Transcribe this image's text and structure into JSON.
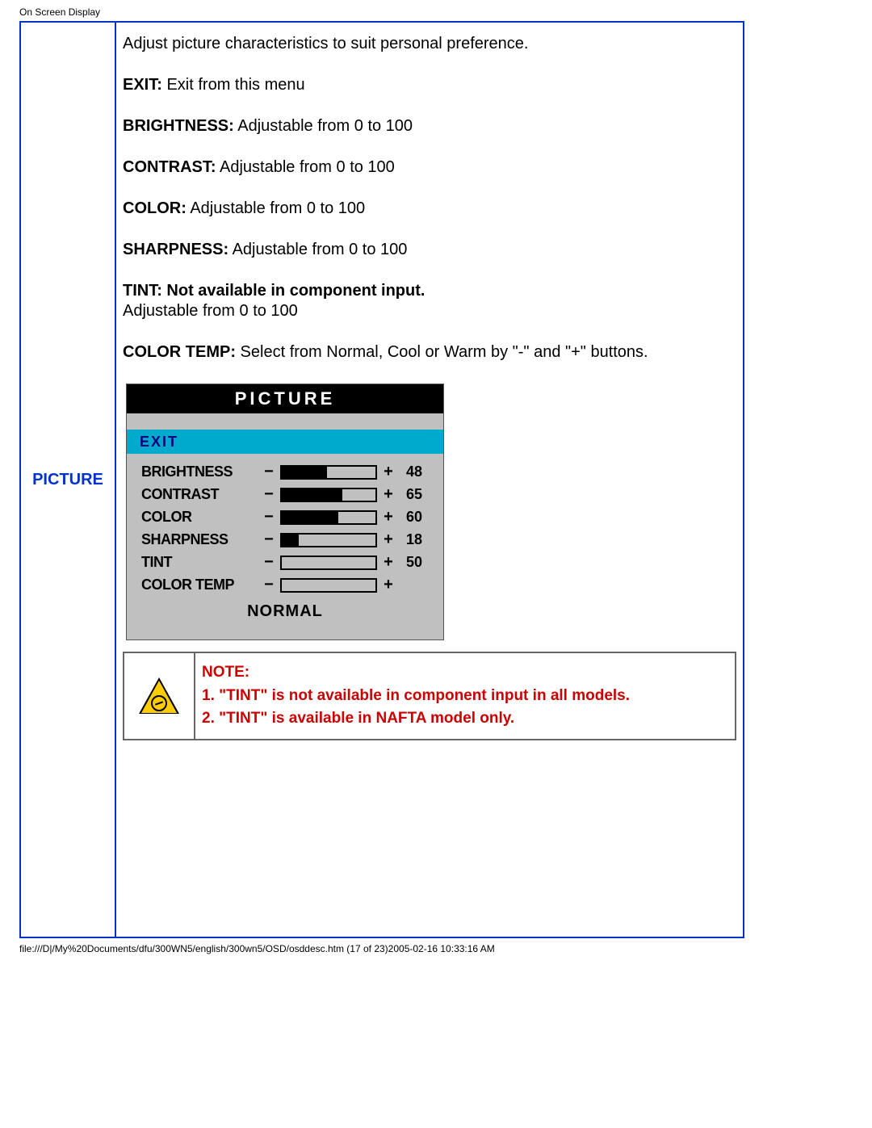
{
  "header": "On Screen Display",
  "footer": "file:///D|/My%20Documents/dfu/300WN5/english/300wn5/OSD/osddesc.htm (17 of 23)2005-02-16 10:33:16 AM",
  "section_label": "PICTURE",
  "intro": "Adjust picture characteristics to suit personal preference.",
  "items": [
    {
      "label": "EXIT:",
      "desc": " Exit from this menu"
    },
    {
      "label": "BRIGHTNESS:",
      "desc": " Adjustable from 0 to 100"
    },
    {
      "label": "CONTRAST:",
      "desc": " Adjustable from 0 to 100"
    },
    {
      "label": "COLOR:",
      "desc": " Adjustable from 0 to 100"
    },
    {
      "label": "SHARPNESS:",
      "desc": " Adjustable from 0 to 100"
    }
  ],
  "tint": {
    "label": "TINT: Not available in component input.",
    "desc": "Adjustable from 0 to 100"
  },
  "colortemp": {
    "label": "COLOR TEMP:",
    "desc": " Select from Normal, Cool or Warm by \"-\" and \"+\" buttons."
  },
  "osd": {
    "title": "PICTURE",
    "exit": "EXIT",
    "rows": [
      {
        "label": "BRIGHTNESS",
        "value": "48",
        "fill": 48
      },
      {
        "label": "CONTRAST",
        "value": "65",
        "fill": 65
      },
      {
        "label": "COLOR",
        "value": "60",
        "fill": 60
      },
      {
        "label": "SHARPNESS",
        "value": "18",
        "fill": 18
      },
      {
        "label": "TINT",
        "value": "50",
        "fill": 0
      },
      {
        "label": "COLOR TEMP",
        "value": "",
        "fill": 0
      }
    ],
    "minus": "−",
    "plus": "+",
    "footer": "NORMAL"
  },
  "note": {
    "title": "NOTE:",
    "line1": "1. \"TINT\" is not available in component input in all models.",
    "line2": "2. \"TINT\" is available in NAFTA model only."
  }
}
